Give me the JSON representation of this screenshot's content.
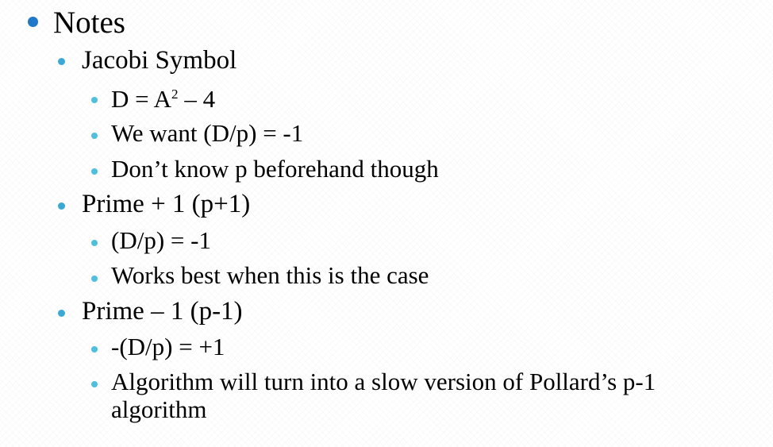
{
  "slide": {
    "heading": "Notes",
    "colors": {
      "level0_bullet": "#1f78c8",
      "level1_bullet": "#3aa9d4",
      "level2_bullet": "#4ec0dd",
      "text": "#000000"
    },
    "sections": [
      {
        "title": "Jacobi Symbol",
        "items": [
          {
            "pre": "D = A",
            "sup": "2",
            "post": " – 4"
          },
          {
            "text": "We want (D/p) = -1"
          },
          {
            "text": "Don’t know p beforehand though"
          }
        ]
      },
      {
        "title": "Prime + 1 (p+1)",
        "items": [
          {
            "text": "(D/p) = -1"
          },
          {
            "text": "Works best when this is the case"
          }
        ]
      },
      {
        "title": "Prime – 1 (p-1)",
        "items": [
          {
            "text": "-(D/p) = +1"
          },
          {
            "text": "Algorithm will turn into a slow version of Pollard’s p-1"
          },
          {
            "text": "algorithm"
          }
        ]
      }
    ]
  }
}
